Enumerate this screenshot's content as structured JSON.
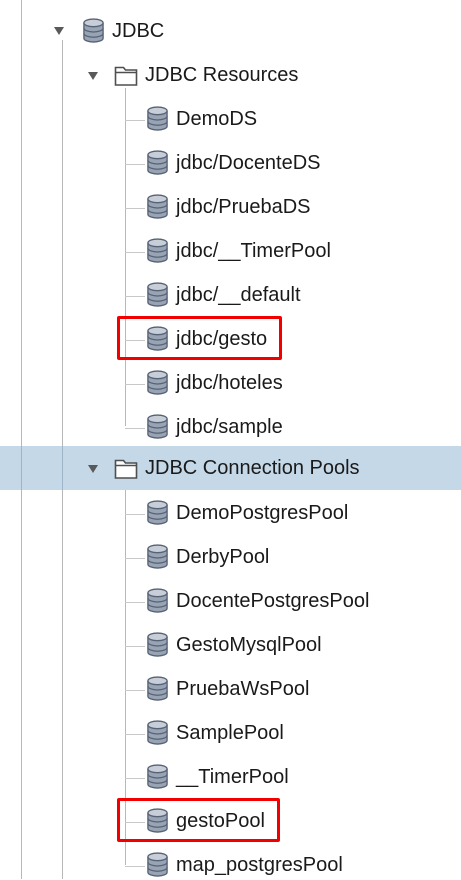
{
  "tree": {
    "root": {
      "label": "JDBC",
      "icon": "database-icon"
    },
    "resources": {
      "label": "JDBC Resources",
      "icon": "folder-icon",
      "items": [
        "DemoDS",
        "jdbc/DocenteDS",
        "jdbc/PruebaDS",
        "jdbc/__TimerPool",
        "jdbc/__default",
        "jdbc/gesto",
        "jdbc/hoteles",
        "jdbc/sample"
      ]
    },
    "pools": {
      "label": "JDBC Connection Pools",
      "icon": "folder-icon",
      "selected": true,
      "items": [
        "DemoPostgresPool",
        "DerbyPool",
        "DocentePostgresPool",
        "GestoMysqlPool",
        "PruebaWsPool",
        "SamplePool",
        "__TimerPool",
        "gestoPool",
        "map_postgresPool"
      ]
    }
  },
  "highlighted": [
    "jdbc/gesto",
    "gestoPool"
  ],
  "colors": {
    "selection": "#c4d8e8",
    "highlight": "#f20000"
  }
}
